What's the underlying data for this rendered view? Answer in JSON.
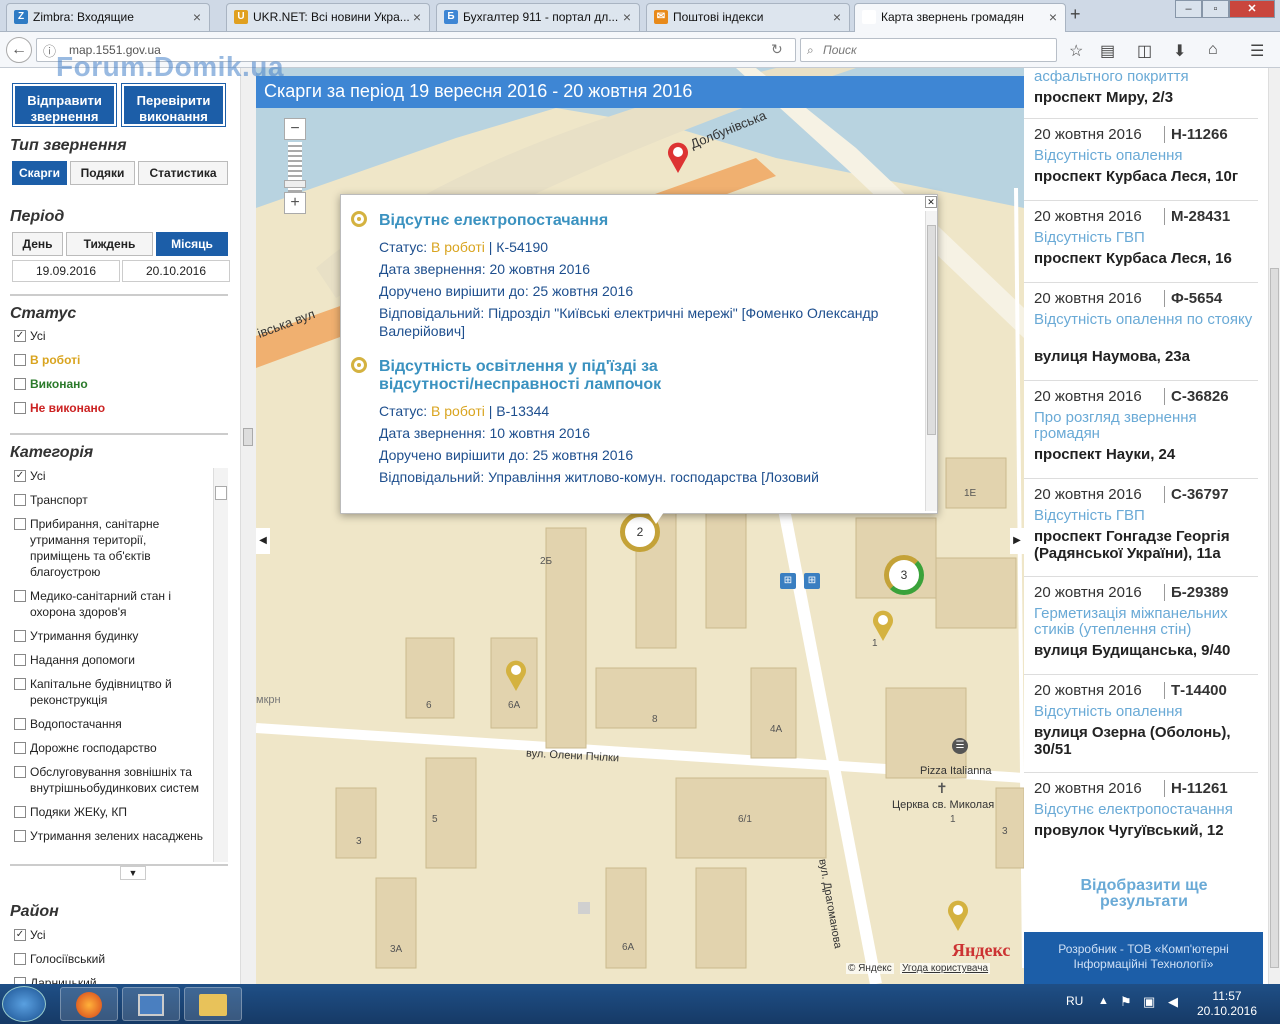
{
  "browser": {
    "tabs": [
      {
        "label": "Zimbra: Входящие",
        "fav": "Z",
        "color": "#2e7bc4"
      },
      {
        "label": "UKR.NET: Всі новини Укра...",
        "fav": "U",
        "color": "#e0a020"
      },
      {
        "label": "Бухгалтер 911 - портал дл...",
        "fav": "Б",
        "color": "#3e86d4"
      },
      {
        "label": "Поштові індекси",
        "fav": "✉",
        "color": "#e88a1a"
      },
      {
        "label": "Карта звернень громадян",
        "fav": "",
        "color": "#ffffff"
      }
    ],
    "url": "map.1551.gov.ua",
    "search_placeholder": "Поиск"
  },
  "watermark": "Forum.Domik.ua",
  "left": {
    "send_button": "Відправити звернення",
    "check_button": "Перевірити виконання",
    "type_heading": "Тип звернення",
    "type_tabs": [
      "Скарги",
      "Подяки",
      "Статистика"
    ],
    "period_heading": "Період",
    "period_tabs": [
      "День",
      "Тиждень",
      "Місяць"
    ],
    "date_from": "19.09.2016",
    "date_to": "20.10.2016",
    "status_heading": "Статус",
    "status": [
      {
        "label": "Усі",
        "checked": true,
        "color": "#222"
      },
      {
        "label": "В роботі",
        "checked": false,
        "color": "#d9a41f"
      },
      {
        "label": "Виконано",
        "checked": false,
        "color": "#2a7a2a"
      },
      {
        "label": "Не виконано",
        "checked": false,
        "color": "#cc2222"
      }
    ],
    "category_heading": "Категорія",
    "categories": [
      {
        "label": "Усі",
        "checked": true
      },
      {
        "label": "Транспорт",
        "checked": false
      },
      {
        "label": "Прибирання, санітарне утримання території, приміщень та об'єктів благоустрою",
        "checked": false
      },
      {
        "label": "Медико-санітарний стан і охорона здоров'я",
        "checked": false
      },
      {
        "label": "Утримання будинку",
        "checked": false
      },
      {
        "label": "Надання допомоги",
        "checked": false
      },
      {
        "label": "Капітальне будівництво й реконструкція",
        "checked": false
      },
      {
        "label": "Водопостачання",
        "checked": false
      },
      {
        "label": "Дорожнє господарство",
        "checked": false
      },
      {
        "label": "Обслуговування зовнішніх та внутрішньобудинкових систем",
        "checked": false
      },
      {
        "label": "Подяки ЖЕКу, КП",
        "checked": false
      },
      {
        "label": "Утримання зелених насаджень",
        "checked": false
      }
    ],
    "district_heading": "Район",
    "districts": [
      {
        "label": "Усі",
        "checked": true
      },
      {
        "label": "Голосіївський",
        "checked": false
      },
      {
        "label": "Дарницький",
        "checked": false
      }
    ]
  },
  "map": {
    "header": "Скарги за період 19 вересня 2016 - 20 жовтня 2016",
    "labels": {
      "street1": "Долбунівська",
      "street2": "івська вул",
      "street3": "вул. Олени Пчілки",
      "street4": "вул. Драгоманова",
      "poi1": "Pizza Italianna",
      "poi2": "Церква св. Миколая",
      "district": "мкрн",
      "copyright": "© Яндекс",
      "terms": "Угода користувача",
      "logo": "Яндекс"
    },
    "buildings": [
      "1Е",
      "2Б",
      "6",
      "6А",
      "8",
      "4А",
      "5",
      "3",
      "6/1",
      "3А",
      "6А",
      "1",
      "1",
      "3"
    ],
    "clusters": [
      "2",
      "3"
    ],
    "popup": [
      {
        "title": "Відсутнє електропостачання",
        "status_label": "Статус:",
        "status": "В роботі",
        "code": "| К-54190",
        "date_line": "Дата звернення: 20  жовтня  2016",
        "due_line": "Доручено вирішити до: 25  жовтня  2016",
        "resp_line": "Відповідальний: Підрозділ \"Київські електричні мережі\" [Фоменко Олександр Валерійович]"
      },
      {
        "title": "Відсутність освітлення у під'їзді за відсутності/несправності лампочок",
        "status_label": "Статус:",
        "status": "В роботі",
        "code": "| В-13344",
        "date_line": "Дата звернення: 10  жовтня  2016",
        "due_line": "Доручено вирішити до: 25  жовтня  2016",
        "resp_line": "Відповідальний: Управління житлово-комун. господарства [Лозовий"
      }
    ]
  },
  "right": {
    "top_category": "асфальтного покриття",
    "top_address": "проспект Миру, 2/3",
    "items": [
      {
        "date": "20 жовтня 2016",
        "num": "Н-11266",
        "cat": "Відсутність опалення",
        "addr": "проспект Курбаса Леся, 10г"
      },
      {
        "date": "20 жовтня 2016",
        "num": "М-28431",
        "cat": "Відсутність ГВП",
        "addr": "проспект Курбаса Леся, 16"
      },
      {
        "date": "20 жовтня 2016",
        "num": "Ф-5654",
        "cat": "Відсутність опалення по стояку",
        "addr": "вулиця Наумова, 23а"
      },
      {
        "date": "20 жовтня 2016",
        "num": "С-36826",
        "cat": "Про розгляд звернення громадян",
        "addr": "проспект Науки, 24"
      },
      {
        "date": "20 жовтня 2016",
        "num": "С-36797",
        "cat": "Відсутність ГВП",
        "addr": "проспект Гонгадзе Георгія (Радянської України), 11а"
      },
      {
        "date": "20 жовтня 2016",
        "num": "Б-29389",
        "cat": "Герметизація міжпанельних стиків (утеплення стін)",
        "addr": "вулиця Будищанська, 9/40"
      },
      {
        "date": "20 жовтня 2016",
        "num": "Т-14400",
        "cat": "Відсутність опалення",
        "addr": "вулиця Озерна (Оболонь), 30/51"
      },
      {
        "date": "20 жовтня 2016",
        "num": "Н-11261",
        "cat": "Відсутнє електропостачання",
        "addr": "провулок Чугуївський, 12"
      }
    ],
    "more_button": "Відобразити ще результати",
    "developer": "Розробник - ТОВ «Комп'ютерні Інформаційні Технології»"
  },
  "taskbar": {
    "lang": "RU",
    "time": "11:57",
    "date": "20.10.2016"
  }
}
